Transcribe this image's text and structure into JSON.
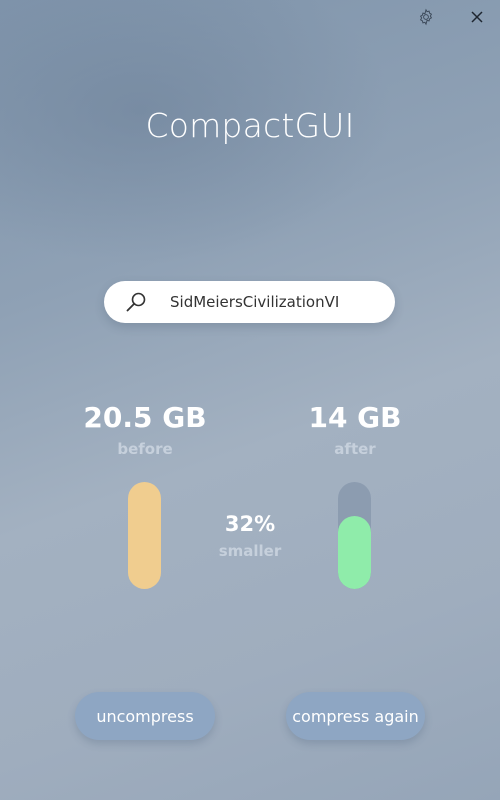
{
  "window": {
    "settings_icon": "gear-icon",
    "close_icon": "close-icon"
  },
  "header": {
    "title": "CompactGUI"
  },
  "search": {
    "icon": "search-icon",
    "value": "SidMeiersCivilizationVI"
  },
  "stats": {
    "before": {
      "value": "20.5 GB",
      "label": "before"
    },
    "after": {
      "value": "14 GB",
      "label": "after"
    },
    "savings": {
      "value": "32%",
      "label": "smaller"
    }
  },
  "bars": {
    "before_fill_fraction": 1.0,
    "after_fill_fraction": 0.68,
    "before_color": "#f0cd8f",
    "after_color": "#8fecaa",
    "track_color": "#8c9cb0"
  },
  "actions": {
    "uncompress_label": "uncompress",
    "compress_again_label": "compress again"
  },
  "colors": {
    "button_bg": "#8ea6c3",
    "label_muted": "#c6d0dc"
  }
}
